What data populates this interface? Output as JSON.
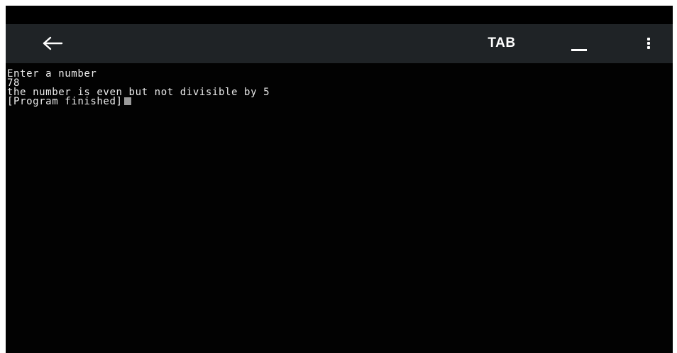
{
  "toolbar": {
    "back_icon": "arrow-left-icon",
    "tab_label": "TAB",
    "minimize_icon": "underscore-icon",
    "more_icon": "vertical-dots-icon"
  },
  "terminal": {
    "lines": [
      "Enter a number",
      "78",
      "the number is even but not divisible by 5",
      "[Program finished]"
    ],
    "cursor_icon": "block-cursor-icon"
  },
  "colors": {
    "toolbar_background": "#1f2326",
    "terminal_background": "#020202",
    "text": "#ececec",
    "cursor": "#9a9a9a"
  }
}
